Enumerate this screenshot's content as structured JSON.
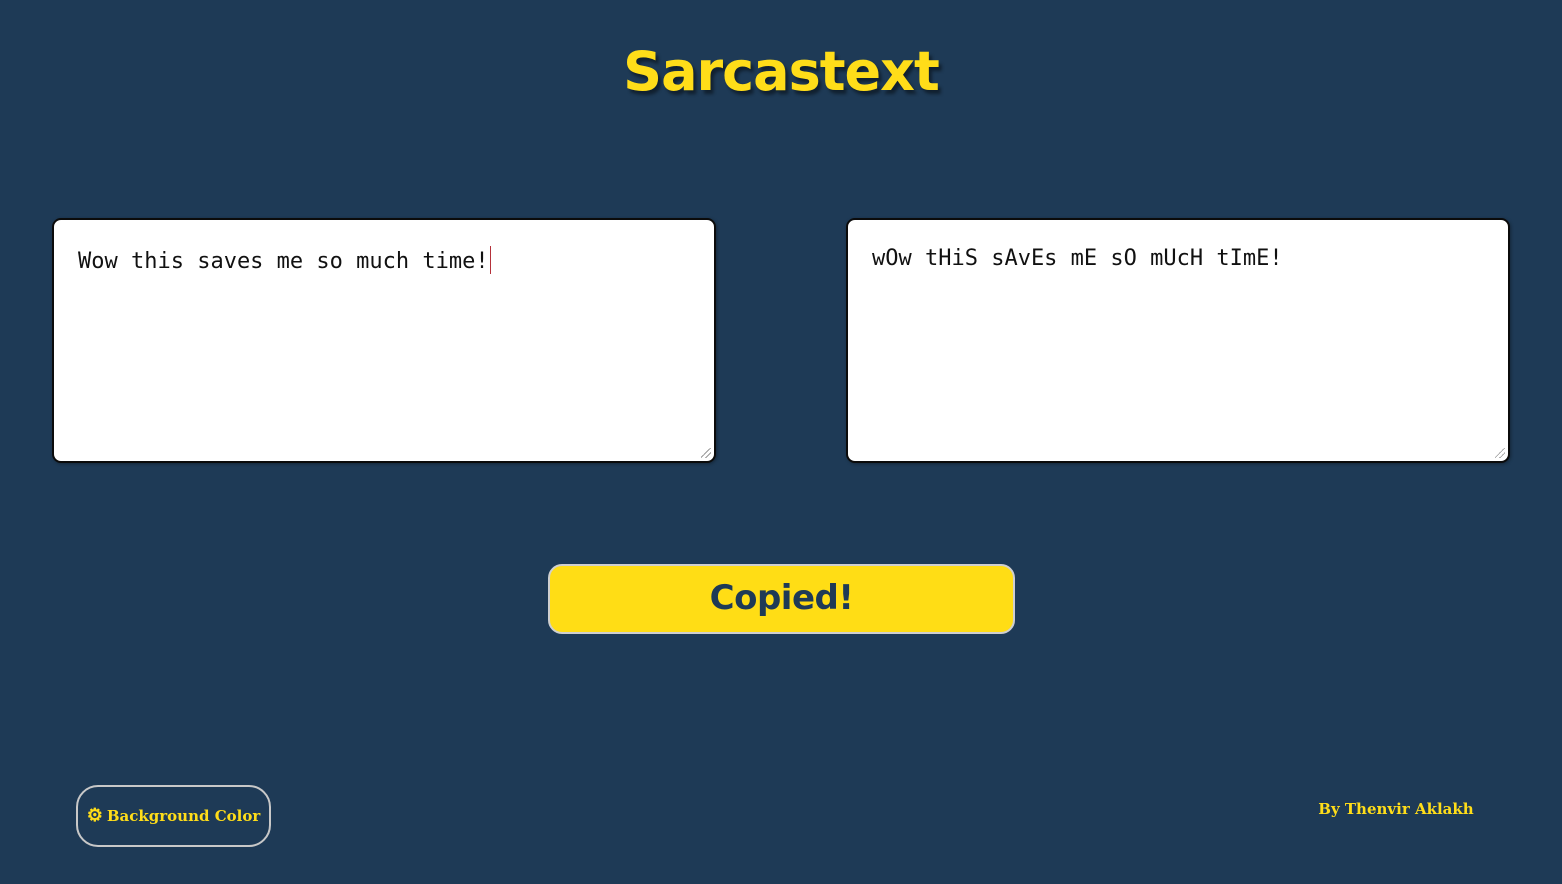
{
  "app": {
    "title": "Sarcastext"
  },
  "input": {
    "value": "Wow this saves me so much time!"
  },
  "output": {
    "value": "wOw tHiS sAvEs mE sO mUcH tImE!"
  },
  "copy_button": {
    "label": "Copied!"
  },
  "background_button": {
    "label": "Background Color",
    "icon": "gear-icon"
  },
  "footer": {
    "credit": "By Thenvir Aklakh"
  },
  "colors": {
    "background": "#1e3a56",
    "accent": "#ffdd19"
  }
}
